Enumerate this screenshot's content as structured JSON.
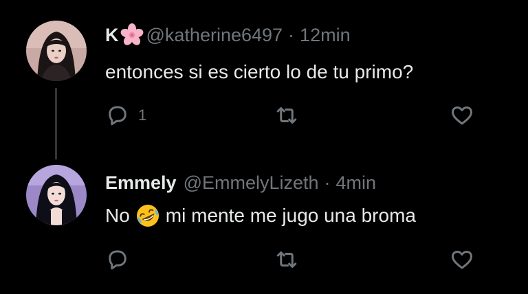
{
  "tweets": [
    {
      "display_name": "K",
      "name_emoji": "cherry-blossom",
      "handle": "@katherine6497",
      "separator": "·",
      "time": "12min",
      "text": "entonces si es cierto lo de tu primo?",
      "reply_count": "1"
    },
    {
      "display_name": "Emmely",
      "handle": "@EmmelyLizeth",
      "separator": "·",
      "time": "4min",
      "text_before": "No",
      "text_emoji": "rolling-on-floor-laughing",
      "text_after": "mi mente me jugo una broma",
      "reply_count": ""
    }
  ],
  "colors": {
    "background": "#000000",
    "text_primary": "#e7e9ea",
    "text_secondary": "#71767b",
    "thread_line": "#333639"
  }
}
